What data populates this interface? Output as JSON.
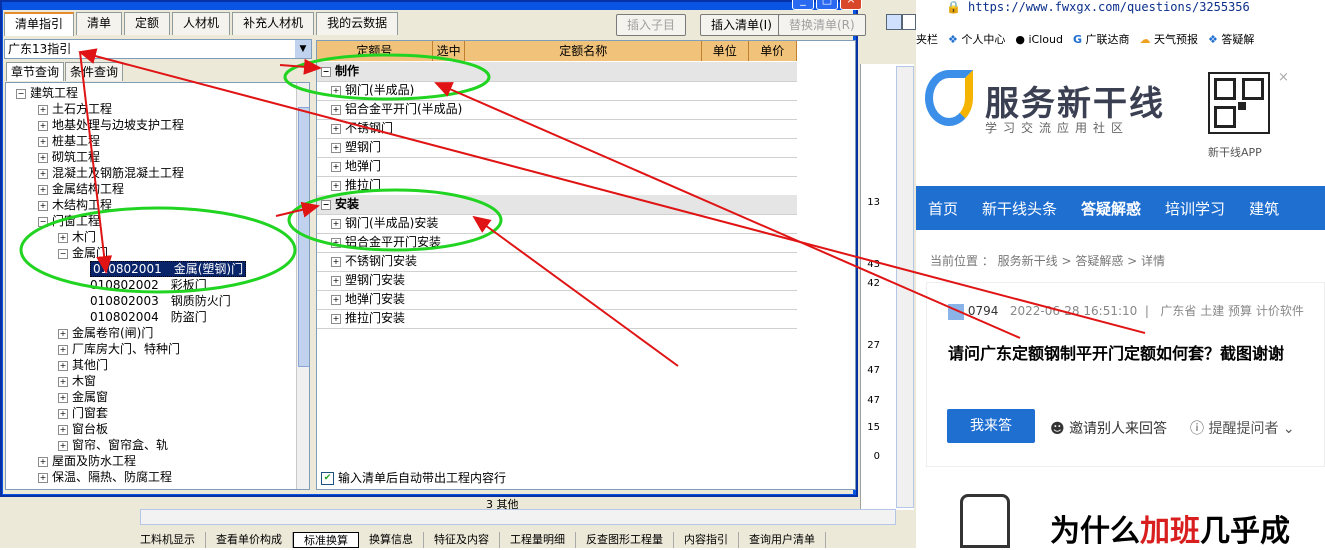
{
  "dialog": {
    "tabs": [
      "清单指引",
      "清单",
      "定额",
      "人材机",
      "补充人材机",
      "我的云数据"
    ],
    "buttons": {
      "insert_sub": "插入子目",
      "insert_list": "插入清单(I)",
      "replace_list": "替换清单(R)"
    },
    "guide_select": "广东13指引",
    "left_tabs": [
      "章节查询",
      "条件查询"
    ],
    "tree": {
      "root": "建筑工程",
      "items": [
        "土石方工程",
        "地基处理与边坡支护工程",
        "桩基工程",
        "砌筑工程",
        "混凝土及钢筋混凝土工程",
        "金属结构工程",
        "木结构工程",
        "门窗工程",
        "木门",
        "金属门",
        "010802001　金属(塑钢)门",
        "010802002　彩板门",
        "010802003　钢质防火门",
        "010802004　防盗门",
        "金属卷帘(闸)门",
        "厂库房大门、特种门",
        "其他门",
        "木窗",
        "金属窗",
        "门窗套",
        "窗台板",
        "窗帘、窗帘盒、轨",
        "屋面及防水工程",
        "保温、隔热、防腐工程"
      ]
    },
    "grid": {
      "headers": [
        "定额号",
        "选中",
        "定额名称",
        "单位",
        "单价"
      ],
      "rows": [
        {
          "kind": "group",
          "name": "制作"
        },
        {
          "kind": "item",
          "name": "钢门(半成品)"
        },
        {
          "kind": "item",
          "name": "铝合金平开门(半成品)"
        },
        {
          "kind": "item",
          "name": "不锈钢门"
        },
        {
          "kind": "item",
          "name": "塑钢门"
        },
        {
          "kind": "item",
          "name": "地弹门"
        },
        {
          "kind": "item",
          "name": "推拉门"
        },
        {
          "kind": "group",
          "name": "安装"
        },
        {
          "kind": "item",
          "name": "钢门(半成品)安装"
        },
        {
          "kind": "item",
          "name": "铝合金平开门安装"
        },
        {
          "kind": "item",
          "name": "不锈钢门安装"
        },
        {
          "kind": "item",
          "name": "塑钢门安装"
        },
        {
          "kind": "item",
          "name": "地弹门安装"
        },
        {
          "kind": "item",
          "name": "推拉门安装"
        }
      ],
      "footer_checkbox": "输入清单后自动带出工程内容行"
    }
  },
  "background_app": {
    "numbers": [
      "13",
      "43",
      "42",
      "27",
      "47",
      "47",
      "15",
      "0"
    ],
    "cell_text": "3 其他",
    "bottom_tabs": [
      "工料机显示",
      "查看单价构成",
      "标准换算",
      "换算信息",
      "特征及内容",
      "工程量明细",
      "反查图形工程量",
      "内容指引",
      "查询用户清单"
    ],
    "active_bottom_tab": "标准换算"
  },
  "browser": {
    "url": "https://www.fwxgx.com/questions/3255356",
    "bookmarks": [
      "夹栏",
      "个人中心",
      "iCloud",
      "广联达商",
      "天气预报",
      "答疑解"
    ],
    "brand": "服务新干线",
    "slogan": "学习交流应用社区",
    "qr_label": "新干线APP",
    "nav": [
      "首页",
      "新干线头条",
      "答疑解惑",
      "培训学习",
      "建筑"
    ],
    "breadcrumb": "当前位置 ： 服务新干线 > 答疑解惑 > 详情",
    "post": {
      "user": "0794",
      "time": "2022-06-28 16:51:10",
      "tags": "广东省  土建  预算  计价软件",
      "title": "请问广东定额钢制平开门定额如何套？截图谢谢",
      "answer_btn": "我来答",
      "invite": "邀请别人来回答",
      "remind": "提醒提问者"
    },
    "ad": {
      "prefix": "为什么",
      "highlight": "加班",
      "suffix": "几乎成"
    }
  },
  "colors": {
    "accent_green": "#21d421",
    "accent_red": "#e01414",
    "nav_blue": "#1f6fd1",
    "grid_header": "#f0c27a"
  }
}
